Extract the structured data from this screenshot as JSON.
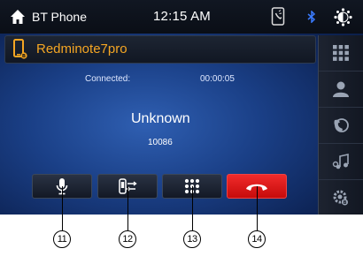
{
  "topbar": {
    "title": "BT Phone",
    "time": "12:15 AM",
    "icons": [
      "home-icon",
      "phone-status-icon",
      "bluetooth-icon",
      "brightness-icon"
    ]
  },
  "device": {
    "name": "Redminote7pro",
    "name_color": "#f5a623"
  },
  "call": {
    "status_label": "Connected:",
    "duration": "00:00:05",
    "caller_name": "Unknown",
    "caller_number": "10086"
  },
  "controls": [
    {
      "name": "microphone-button",
      "icon": "microphone-icon"
    },
    {
      "name": "switch-audio-button",
      "icon": "phone-transfer-icon"
    },
    {
      "name": "dialpad-button",
      "icon": "keypad-icon"
    },
    {
      "name": "hang-up-button",
      "icon": "end-call-icon"
    }
  ],
  "sidebar": [
    "keypad-icon",
    "contacts-icon",
    "call-history-icon",
    "music-icon",
    "settings-icon"
  ],
  "callouts": [
    "11",
    "12",
    "13",
    "14"
  ],
  "colors": {
    "accent": "#f5a623",
    "end_call": "#e01818",
    "background": "#1a3f86"
  }
}
